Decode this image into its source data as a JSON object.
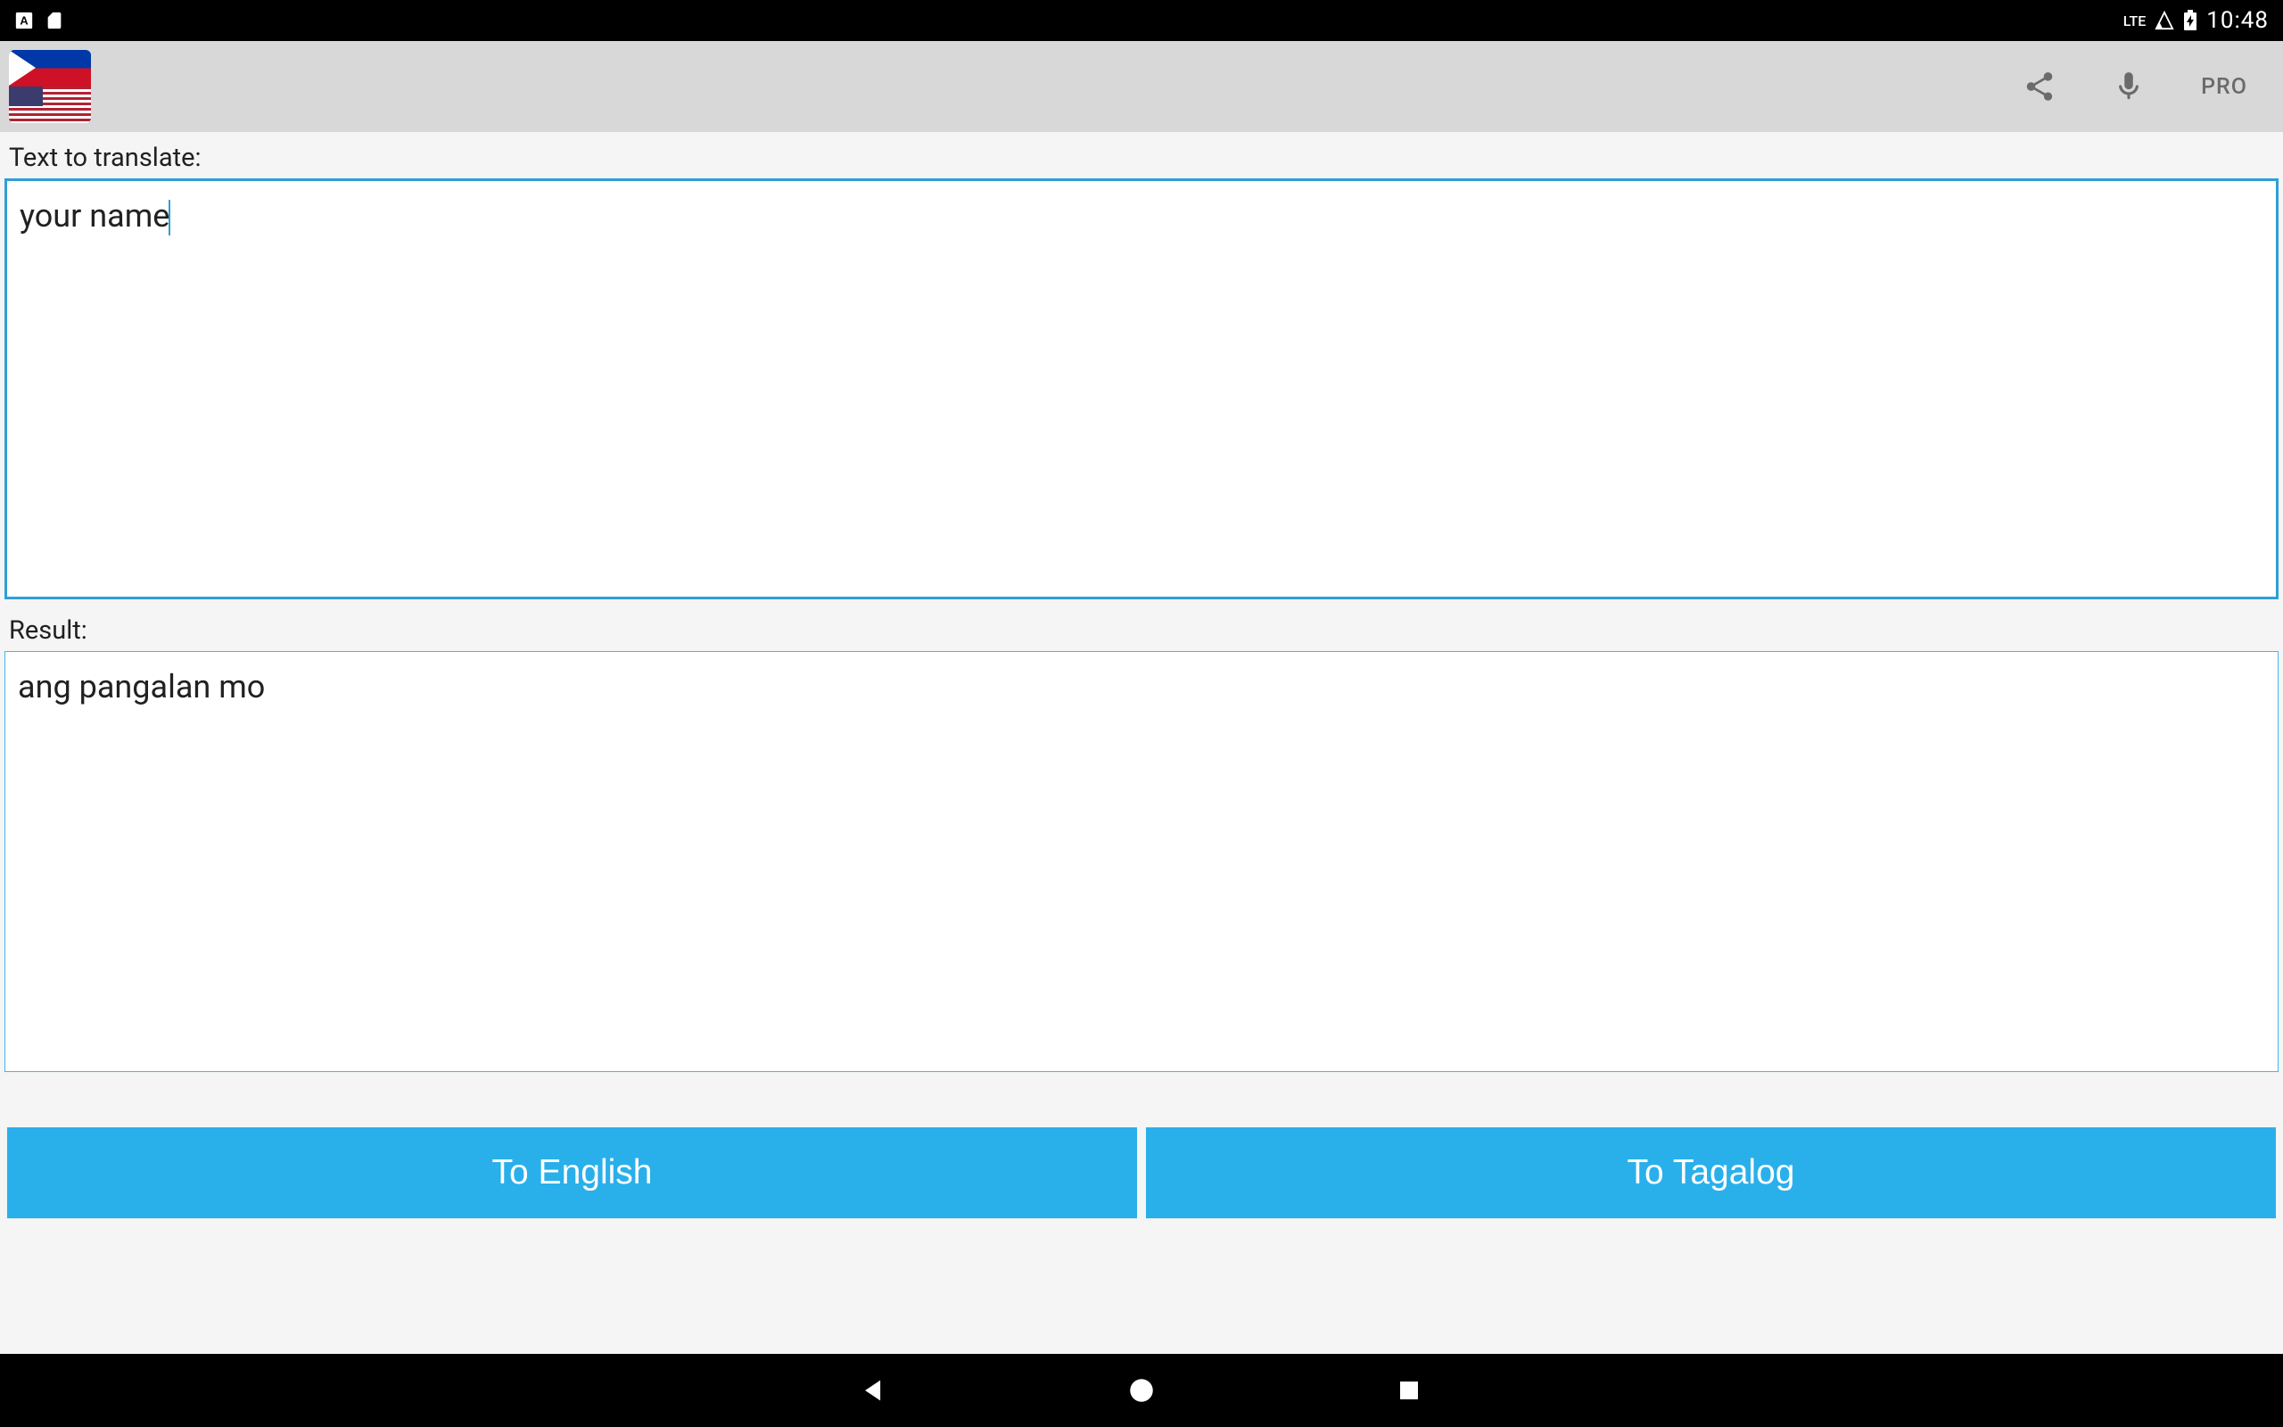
{
  "status_bar": {
    "lte_label": "LTE",
    "time": "10:48"
  },
  "app_bar": {
    "pro_label": "PRO"
  },
  "input": {
    "label": "Text to translate:",
    "value": "your name"
  },
  "result": {
    "label": "Result:",
    "value": "ang pangalan mo"
  },
  "buttons": {
    "to_english": "To English",
    "to_tagalog": "To Tagalog"
  }
}
